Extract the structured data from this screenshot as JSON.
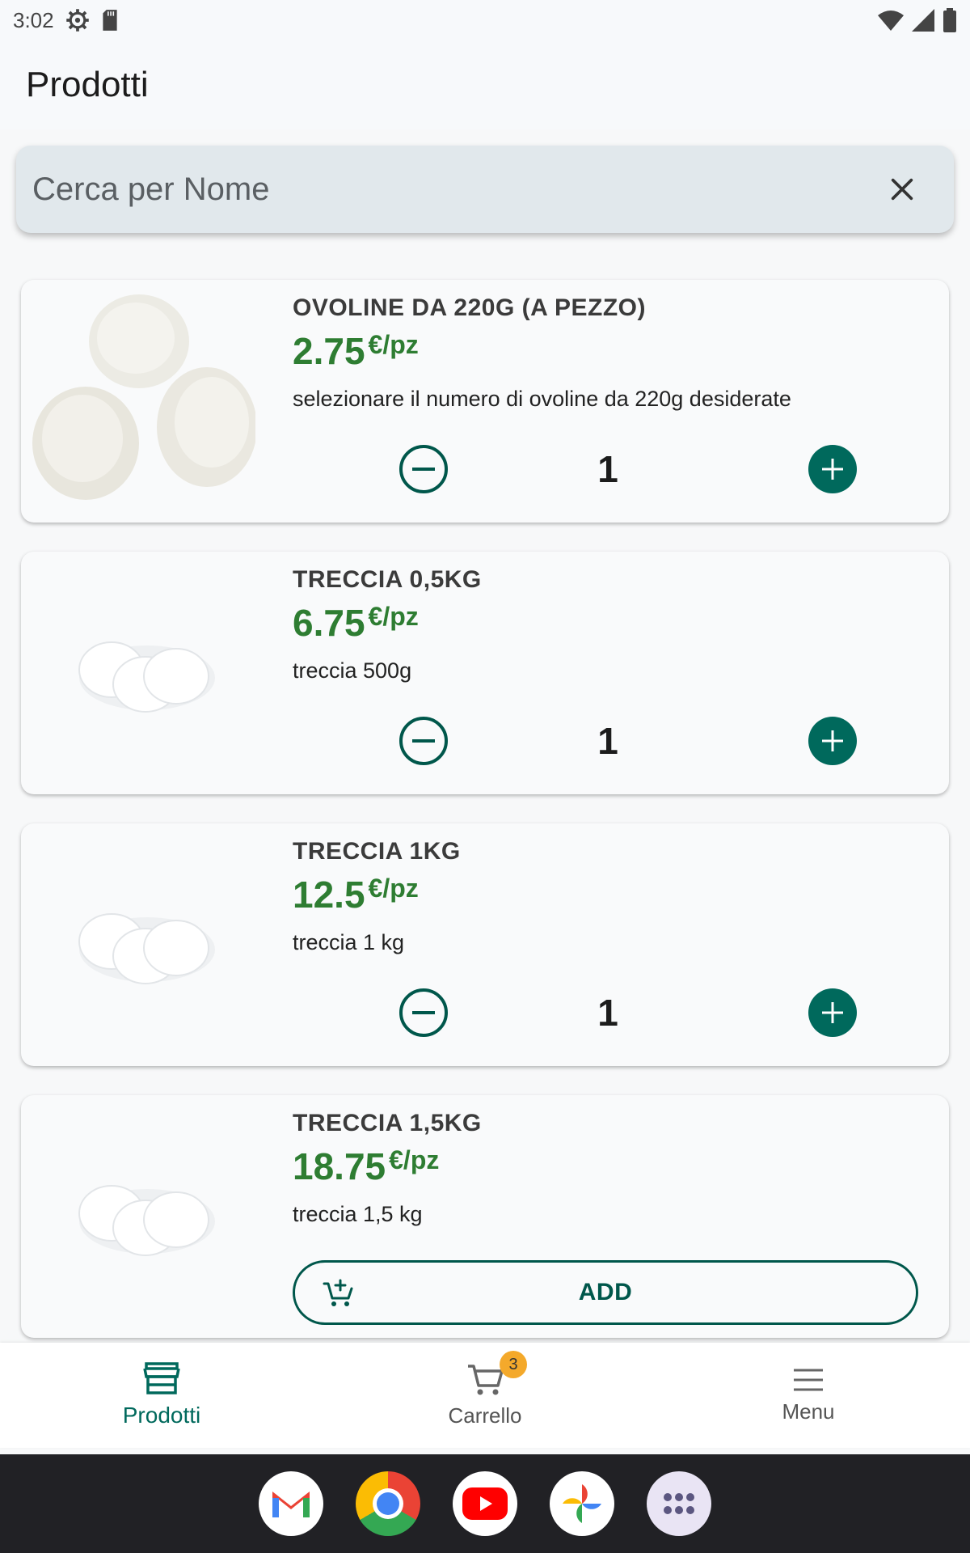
{
  "status_bar": {
    "time": "3:02"
  },
  "app_bar": {
    "title": "Prodotti"
  },
  "search": {
    "placeholder": "Cerca per Nome",
    "value": ""
  },
  "products": [
    {
      "name": "OVOLINE DA 220G (A PEZZO)",
      "price": "2.75",
      "unit": "€/pz",
      "description": "selezionare il numero di ovoline da 220g desiderate",
      "quantity": "1",
      "image": "ovoline-image"
    },
    {
      "name": "TRECCIA 0,5KG",
      "price": "6.75",
      "unit": "€/pz",
      "description": "treccia 500g",
      "quantity": "1",
      "image": "treccia-image"
    },
    {
      "name": "TRECCIA 1KG",
      "price": "12.5",
      "unit": "€/pz",
      "description": "treccia 1 kg",
      "quantity": "1",
      "image": "treccia-image"
    },
    {
      "name": "TRECCIA 1,5KG",
      "price": "18.75",
      "unit": "€/pz",
      "description": "treccia 1,5 kg",
      "add_label": "ADD",
      "image": "treccia-image"
    }
  ],
  "bottom_nav": {
    "items": [
      {
        "label": "Prodotti",
        "icon": "store-icon",
        "active": true
      },
      {
        "label": "Carrello",
        "icon": "cart-icon",
        "badge": "3"
      },
      {
        "label": "Menu",
        "icon": "hamburger-icon"
      }
    ]
  },
  "dock": {
    "apps": [
      "gmail-icon",
      "chrome-icon",
      "youtube-icon",
      "photos-icon",
      "apps-grid-icon"
    ]
  },
  "colors": {
    "accent": "#00695c",
    "price": "#2e7d32",
    "badge": "#f4a92b",
    "search_bg": "#e1e8ec"
  }
}
